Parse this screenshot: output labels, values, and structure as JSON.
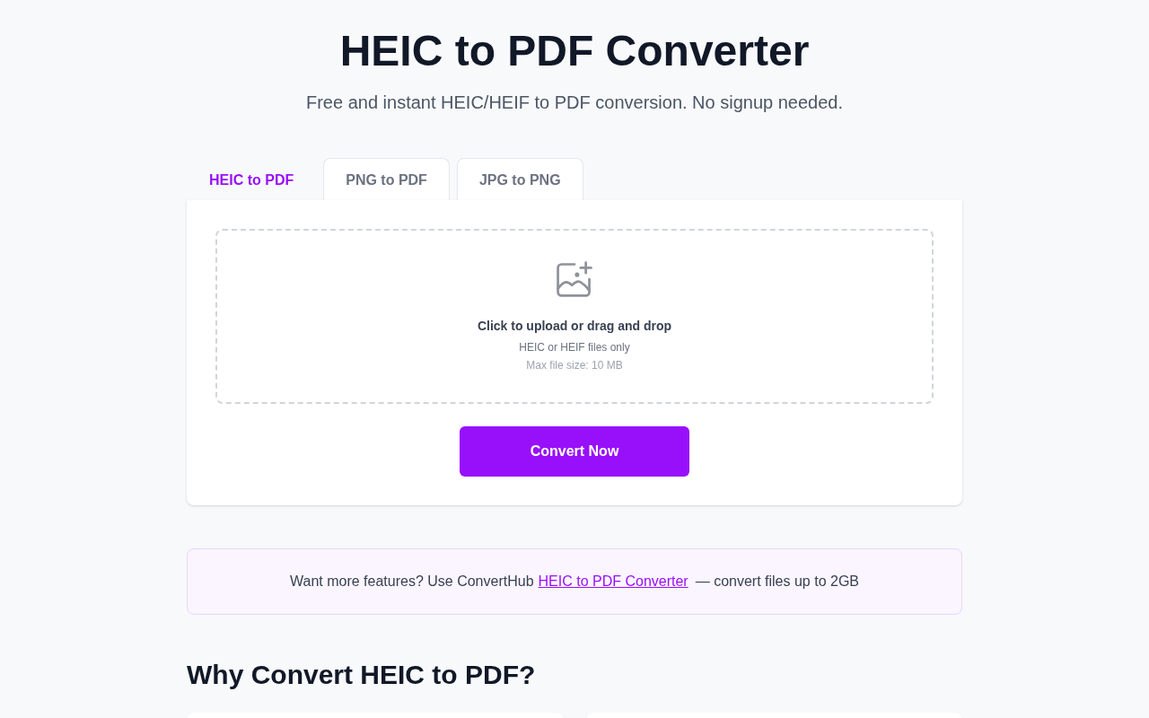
{
  "header": {
    "title": "HEIC to PDF Converter",
    "subtitle": "Free and instant HEIC/HEIF to PDF conversion. No signup needed."
  },
  "tabs": [
    {
      "label": "HEIC to PDF",
      "selected": true
    },
    {
      "label": "PNG to PDF",
      "selected": false
    },
    {
      "label": "JPG to PNG",
      "selected": false
    }
  ],
  "upload": {
    "prompt": "Click to upload or drag and drop",
    "formats": "HEIC or HEIF files only",
    "max_size": "Max file size: 10 MB"
  },
  "convert_button": {
    "label": "Convert Now"
  },
  "promo": {
    "text_before": "Want more features? Use ConvertHub",
    "link": "HEIC to PDF Converter",
    "text_after": "— convert files up to 2GB"
  },
  "why_section": {
    "heading": "Why Convert HEIC to PDF?"
  }
}
